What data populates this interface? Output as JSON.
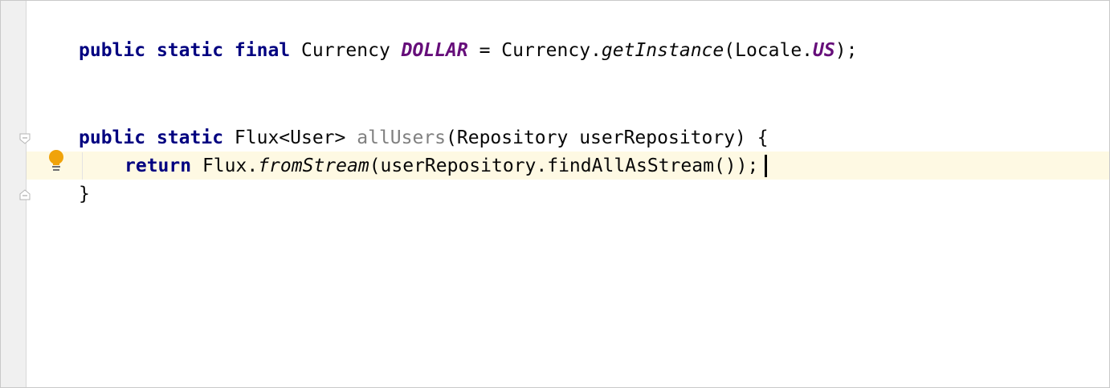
{
  "editor": {
    "line1": {
      "kw_public": "public",
      "kw_static": "static",
      "kw_final": "final",
      "type": "Currency",
      "field": "DOLLAR",
      "assign": " = Currency.",
      "method": "getInstance",
      "args_open": "(Locale.",
      "arg_const": "US",
      "close": ");"
    },
    "line2": {
      "kw_public": "public",
      "kw_static": "static",
      "return_type": "Flux<User>",
      "method": "allUsers",
      "params": "(Repository userRepository) {"
    },
    "line3": {
      "kw_return": "return",
      "obj": "Flux.",
      "method": "fromStream",
      "args": "(userRepository.findAllAsStream());"
    },
    "line4": {
      "brace": "}"
    },
    "gutter_icons": [
      "fold-start-icon",
      "lightbulb-icon",
      "fold-end-icon"
    ],
    "colors": {
      "keyword": "#000080",
      "static_field": "#660e7a",
      "unused_symbol": "#808080",
      "current_line": "#fef9e3",
      "bulb": "#f0a30a"
    }
  }
}
